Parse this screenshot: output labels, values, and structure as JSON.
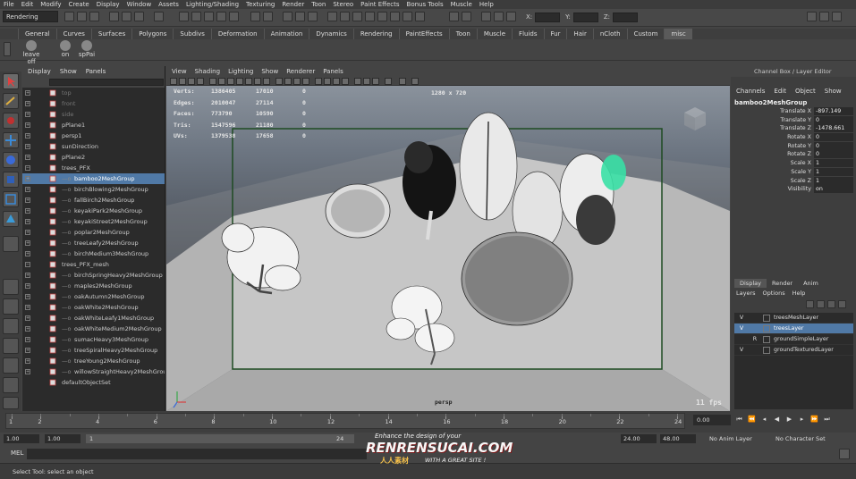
{
  "menubar": [
    "File",
    "Edit",
    "Modify",
    "Create",
    "Display",
    "Window",
    "Assets",
    "Lighting/Shading",
    "Texturing",
    "Render",
    "Toon",
    "Stereo",
    "Paint Effects",
    "Bonus Tools",
    "Muscle",
    "Help"
  ],
  "status": {
    "mode": "Rendering",
    "x_label": "X:",
    "y_label": "Y:",
    "z_label": "Z:"
  },
  "shelf": {
    "tabs": [
      "General",
      "Curves",
      "Surfaces",
      "Polygons",
      "Subdivs",
      "Deformation",
      "Animation",
      "Dynamics",
      "Rendering",
      "PaintEffects",
      "Toon",
      "Muscle",
      "Fluids",
      "Fur",
      "Hair",
      "nCloth",
      "Custom",
      "misc"
    ],
    "active_tab": "misc",
    "buttons": [
      "leave off",
      "on",
      "spPai"
    ]
  },
  "outliner": {
    "menu": [
      "Display",
      "Show",
      "Panels"
    ],
    "items": [
      {
        "label": "top",
        "dim": true,
        "indent": 0,
        "expand": "+"
      },
      {
        "label": "front",
        "dim": true,
        "indent": 0,
        "expand": "+"
      },
      {
        "label": "side",
        "dim": true,
        "indent": 0,
        "expand": "+"
      },
      {
        "label": "pPlane1",
        "indent": 0,
        "expand": "+"
      },
      {
        "label": "persp1",
        "indent": 0,
        "expand": "+"
      },
      {
        "label": "sunDirection",
        "indent": 0,
        "expand": "+"
      },
      {
        "label": "pPlane2",
        "indent": 0,
        "expand": "+"
      },
      {
        "label": "trees_PFX",
        "indent": 0,
        "expand": "−"
      },
      {
        "label": "bamboo2MeshGroup",
        "indent": 1,
        "expand": "+",
        "selected": true
      },
      {
        "label": "birchBlowing2MeshGroup",
        "indent": 1,
        "expand": "+"
      },
      {
        "label": "fallBirch2MeshGroup",
        "indent": 1,
        "expand": "+"
      },
      {
        "label": "keyakiPark2MeshGroup",
        "indent": 1,
        "expand": "+"
      },
      {
        "label": "keyakiStreet2MeshGroup",
        "indent": 1,
        "expand": "+"
      },
      {
        "label": "poplar2MeshGroup",
        "indent": 1,
        "expand": "+"
      },
      {
        "label": "treeLeafy2MeshGroup",
        "indent": 1,
        "expand": "+"
      },
      {
        "label": "birchMedium3MeshGroup",
        "indent": 1,
        "expand": "+"
      },
      {
        "label": "trees_PFX_mesh",
        "indent": 0,
        "expand": "−"
      },
      {
        "label": "birchSpringHeavy2MeshGroup",
        "indent": 1,
        "expand": "+"
      },
      {
        "label": "maples2MeshGroup",
        "indent": 1,
        "expand": "+"
      },
      {
        "label": "oakAutumn2MeshGroup",
        "indent": 1,
        "expand": "+"
      },
      {
        "label": "oakWhite2MeshGroup",
        "indent": 1,
        "expand": "+"
      },
      {
        "label": "oakWhiteLeafy1MeshGroup",
        "indent": 1,
        "expand": "+"
      },
      {
        "label": "oakWhiteMedium2MeshGroup",
        "indent": 1,
        "expand": "+"
      },
      {
        "label": "sumacHeavy3MeshGroup",
        "indent": 1,
        "expand": "+"
      },
      {
        "label": "treeSpiralHeavy2MeshGroup",
        "indent": 1,
        "expand": "+"
      },
      {
        "label": "treeYoung2MeshGroup",
        "indent": 1,
        "expand": "+"
      },
      {
        "label": "willowStraightHeavy2MeshGroup",
        "indent": 1,
        "expand": "+"
      },
      {
        "label": "defaultObjectSet",
        "indent": 0,
        "expand": ""
      }
    ]
  },
  "viewport": {
    "menu": [
      "View",
      "Shading",
      "Lighting",
      "Show",
      "Renderer",
      "Panels"
    ],
    "resolution": "1280 x 720",
    "camera": "persp",
    "fps": "11 fps",
    "hud": [
      {
        "label": "Verts:",
        "v1": "1386405",
        "v2": "17010",
        "v3": "0"
      },
      {
        "label": "Edges:",
        "v1": "2010047",
        "v2": "27114",
        "v3": "0"
      },
      {
        "label": "Faces:",
        "v1": "773790",
        "v2": "10590",
        "v3": "0"
      },
      {
        "label": "Tris:",
        "v1": "1547596",
        "v2": "21180",
        "v3": "0"
      },
      {
        "label": "UVs:",
        "v1": "1379538",
        "v2": "17658",
        "v3": "0"
      }
    ],
    "colors": {
      "ground": "#c4c4c4",
      "sky": "#7d8690",
      "selected": "#39e0a5",
      "gate": "#1e4b22"
    }
  },
  "channel_box": {
    "title": "Channel Box / Layer Editor",
    "menu": [
      "Channels",
      "Edit",
      "Object",
      "Show"
    ],
    "object": "bamboo2MeshGroup",
    "channels": [
      {
        "label": "Translate X",
        "value": "-897.149"
      },
      {
        "label": "Translate Y",
        "value": "0"
      },
      {
        "label": "Translate Z",
        "value": "-1478.661"
      },
      {
        "label": "Rotate X",
        "value": "0"
      },
      {
        "label": "Rotate Y",
        "value": "0"
      },
      {
        "label": "Rotate Z",
        "value": "0"
      },
      {
        "label": "Scale X",
        "value": "1"
      },
      {
        "label": "Scale Y",
        "value": "1"
      },
      {
        "label": "Scale Z",
        "value": "1"
      },
      {
        "label": "Visibility",
        "value": "on"
      }
    ]
  },
  "layer_editor": {
    "tabs": [
      "Display",
      "Render",
      "Anim"
    ],
    "active_tab": "Display",
    "menu": [
      "Layers",
      "Options",
      "Help"
    ],
    "layers": [
      {
        "v": "V",
        "t": "",
        "name": "treesMeshLayer"
      },
      {
        "v": "V",
        "t": "",
        "name": "treesLayer",
        "selected": true
      },
      {
        "v": "",
        "t": "R",
        "name": "groundSimpleLayer"
      },
      {
        "v": "V",
        "t": "",
        "name": "groundTexturedLayer"
      }
    ]
  },
  "timeline": {
    "ticks": [
      "1",
      "2",
      "4",
      "6",
      "8",
      "10",
      "12",
      "14",
      "16",
      "18",
      "20",
      "22",
      "24"
    ],
    "current_frame": "0.00"
  },
  "range": {
    "start": "1.00",
    "start2": "1.00",
    "slider_start": "1",
    "slider_end": "24",
    "end": "24.00",
    "end2": "48.00",
    "anim_layer": "No Anim Layer",
    "character_set": "No Character Set"
  },
  "command": {
    "label": "MEL"
  },
  "help": {
    "text": "Select Tool: select an object"
  },
  "watermark": {
    "line1": "Enhance the design of your",
    "line2": "RENRENSUCAI.COM",
    "line3": "人人素材",
    "line4": "WITH A GREAT SITE !"
  }
}
